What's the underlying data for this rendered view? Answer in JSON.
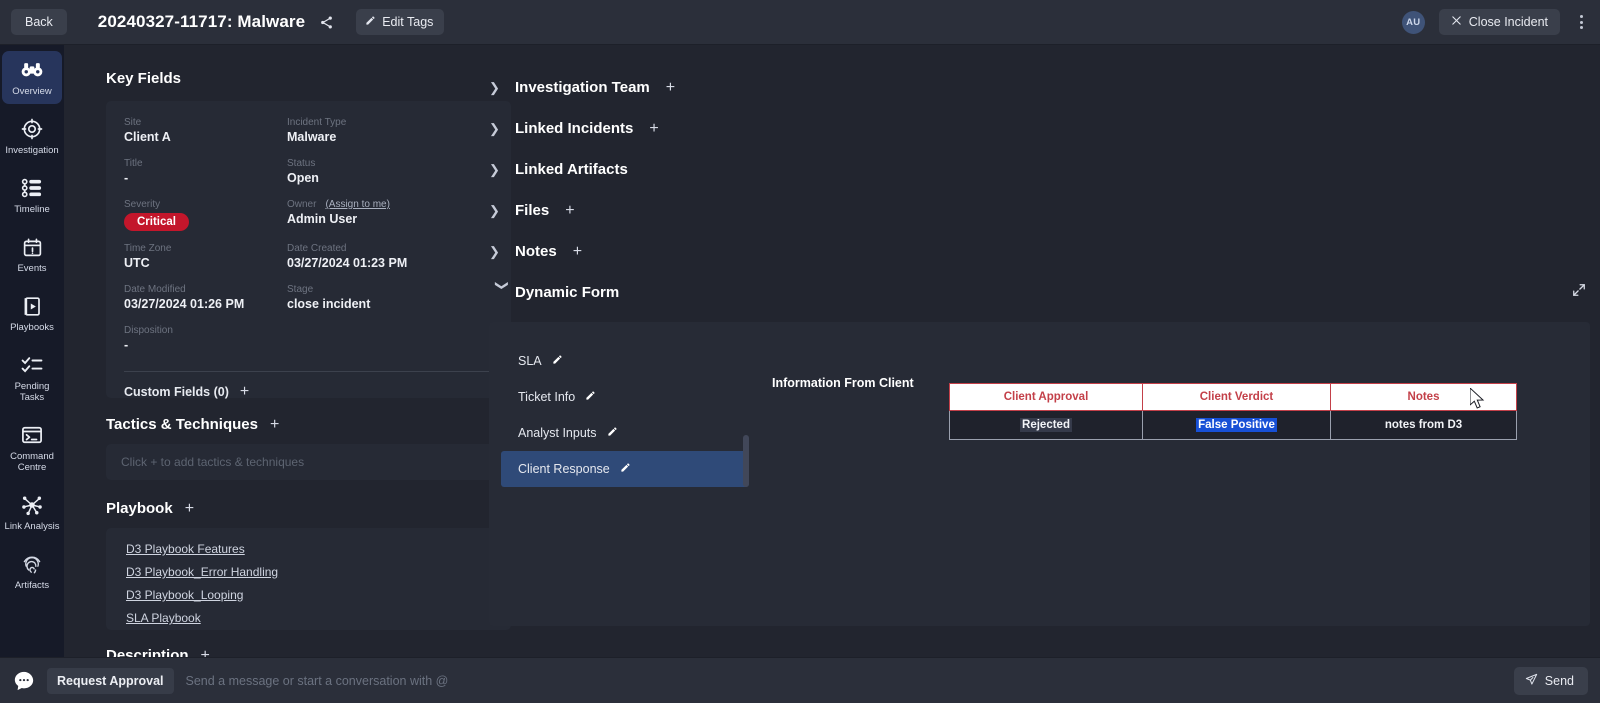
{
  "topbar": {
    "back_label": "Back",
    "incident_title": "20240327-11717: Malware",
    "share_icon": "share-icon",
    "edit_tags_label": "Edit Tags",
    "avatar_initials": "AU",
    "close_incident_label": "Close Incident",
    "more_menu_icon": "kebab-menu-icon"
  },
  "sidebar": {
    "items": [
      {
        "label": "Overview",
        "icon": "binoculars-icon",
        "active": true
      },
      {
        "label": "Investigation",
        "icon": "target-icon",
        "active": false
      },
      {
        "label": "Timeline",
        "icon": "timeline-icon",
        "active": false
      },
      {
        "label": "Events",
        "icon": "calendar-alert-icon",
        "active": false
      },
      {
        "label": "Playbooks",
        "icon": "playbook-icon",
        "active": false
      },
      {
        "label": "Pending Tasks",
        "icon": "checklist-icon",
        "active": false
      },
      {
        "label": "Command Centre",
        "icon": "terminal-icon",
        "active": false
      },
      {
        "label": "Link Analysis",
        "icon": "network-graph-icon",
        "active": false
      },
      {
        "label": "Artifacts",
        "icon": "fingerprint-icon",
        "active": false
      }
    ]
  },
  "key_fields": {
    "title": "Key Fields",
    "fields": [
      {
        "label": "Site",
        "value": "Client A"
      },
      {
        "label": "Incident Type",
        "value": "Malware"
      },
      {
        "label": "Title",
        "value": "-"
      },
      {
        "label": "Status",
        "value": "Open"
      },
      {
        "label": "Severity",
        "value": "Critical"
      },
      {
        "label": "Owner",
        "value": "Admin User",
        "link": "(Assign to me)"
      },
      {
        "label": "Time Zone",
        "value": "UTC"
      },
      {
        "label": "Date Created",
        "value": "03/27/2024 01:23 PM"
      },
      {
        "label": "Date Modified",
        "value": "03/27/2024 01:26 PM"
      },
      {
        "label": "Stage",
        "value": "close incident"
      },
      {
        "label": "Disposition",
        "value": "-"
      }
    ],
    "custom_fields_label": "Custom Fields (0)",
    "severity_color": "#c3162b"
  },
  "tactics": {
    "title": "Tactics & Techniques",
    "placeholder": "Click + to add tactics & techniques"
  },
  "playbook": {
    "title": "Playbook",
    "links": [
      "D3 Playbook Features",
      "D3 Playbook_Error Handling",
      "D3 Playbook_Looping",
      "SLA Playbook"
    ]
  },
  "description": {
    "title": "Description"
  },
  "accordions": [
    {
      "label": "Investigation Team",
      "expanded": false,
      "has_plus": true
    },
    {
      "label": "Linked Incidents",
      "expanded": false,
      "has_plus": true
    },
    {
      "label": "Linked Artifacts",
      "expanded": false,
      "has_plus": false
    },
    {
      "label": "Files",
      "expanded": false,
      "has_plus": true
    },
    {
      "label": "Notes",
      "expanded": false,
      "has_plus": true
    }
  ],
  "dynamic_form": {
    "title": "Dynamic Form",
    "expanded": true,
    "expand_icon": "expand-diagonal-icon",
    "tabs": [
      {
        "label": "SLA",
        "active": false
      },
      {
        "label": "Ticket Info",
        "active": false
      },
      {
        "label": "Analyst Inputs",
        "active": false
      },
      {
        "label": "Client Response",
        "active": true
      }
    ],
    "section_label": "Information From Client",
    "table": {
      "headers": [
        "Client Approval",
        "Client Verdict",
        "Notes"
      ],
      "rows": [
        [
          "Rejected",
          "False Positive",
          "notes from D3"
        ]
      ],
      "header_text_color": "#c34049",
      "header_bg_color": "#ffffff",
      "selection_color": "#1750d6"
    }
  },
  "bottombar": {
    "chat_icon": "chat-bubble-icon",
    "request_approval_label": "Request Approval",
    "message_placeholder": "Send a message or start a conversation with @",
    "send_label": "Send"
  }
}
